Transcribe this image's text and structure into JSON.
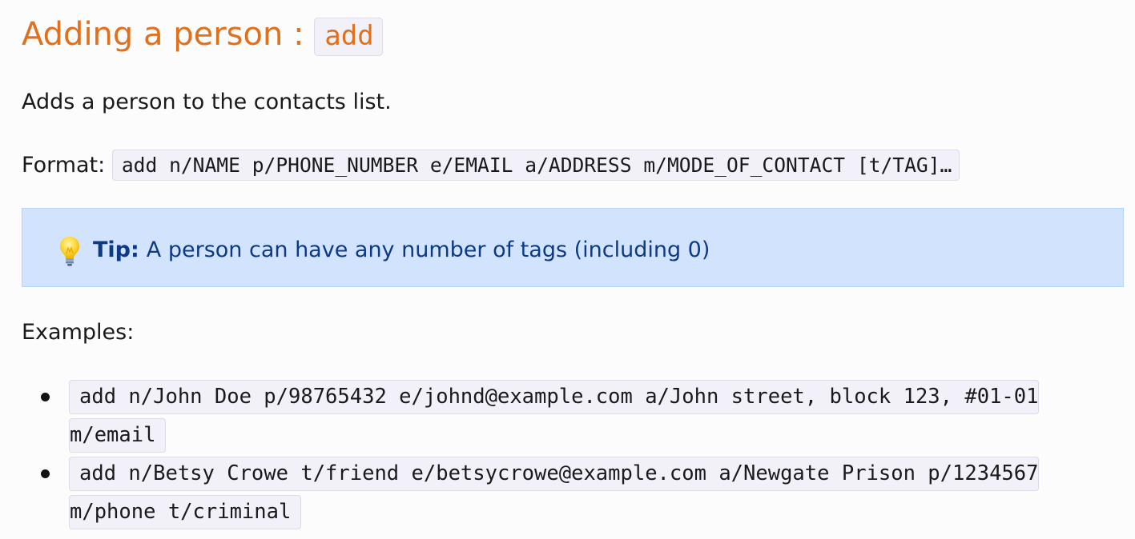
{
  "heading": {
    "text": "Adding a person :",
    "command": "add"
  },
  "description": "Adds a person to the contacts list.",
  "format": {
    "label": "Format:",
    "code": "add n/NAME p/PHONE_NUMBER e/EMAIL a/ADDRESS m/MODE_OF_CONTACT [t/TAG]…"
  },
  "tip": {
    "icon": "lightbulb-icon",
    "label": "Tip:",
    "text": "A person can have any number of tags (including 0)"
  },
  "examples": {
    "label": "Examples:",
    "items": [
      {
        "line1": "add n/John Doe p/98765432 e/johnd@example.com a/John street, block 123, #01-01",
        "line2": "m/email"
      },
      {
        "line1": "add n/Betsy Crowe t/friend e/betsycrowe@example.com a/Newgate Prison p/1234567",
        "line2": "m/phone t/criminal"
      }
    ]
  },
  "colors": {
    "heading": "#e0701e",
    "tip_background": "#d1e3fd",
    "tip_text": "#0d3a86",
    "code_background": "#f2f0f8"
  }
}
